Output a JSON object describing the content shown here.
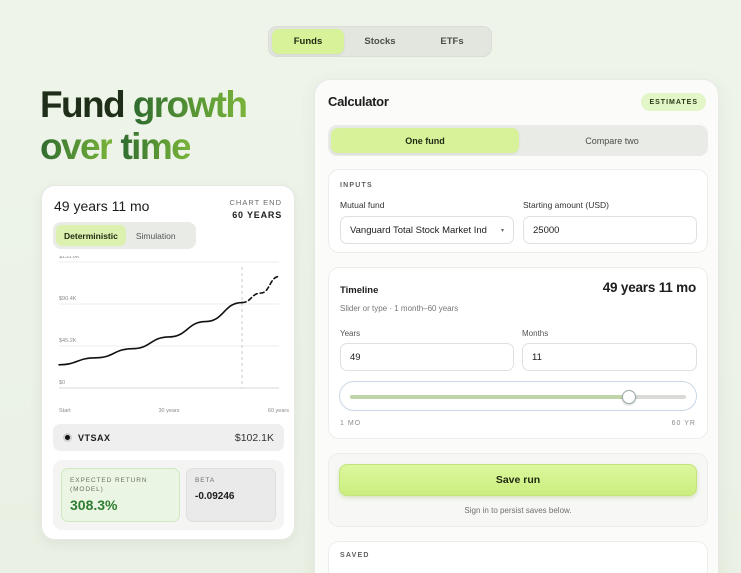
{
  "topnav": {
    "tabs": [
      "Funds",
      "Stocks",
      "ETFs"
    ],
    "active": "Funds"
  },
  "hero": {
    "line1_a": "Fund",
    "line1_b": "growth",
    "line2_a": "over",
    "line2_b": "time"
  },
  "chart_card": {
    "duration": "49 years 11 mo",
    "chart_end_label": "CHART END",
    "chart_end_value": "60 YEARS",
    "modes": [
      "Deterministic",
      "Simulation"
    ],
    "active_mode": "Deterministic",
    "fund_ticker": "VTSAX",
    "fund_value": "$102.1K",
    "expected_return_label": "EXPECTED RETURN (MODEL)",
    "expected_return_value": "308.3%",
    "beta_label": "BETA",
    "beta_value": "-0.09246"
  },
  "chart_data": {
    "type": "line",
    "x_ticks": [
      "Start",
      "30 years",
      "60 years"
    ],
    "y_ticks": [
      "$0",
      "$45.2K",
      "$90.4K",
      "$135.6K"
    ],
    "xlim": [
      0,
      60
    ],
    "ylim": [
      0,
      135600
    ],
    "marker_x": 49.92,
    "series": [
      {
        "style": "solid",
        "x": [
          0,
          10,
          20,
          30,
          40,
          49.92
        ],
        "y": [
          25000,
          32500,
          42300,
          55000,
          71500,
          92000
        ]
      },
      {
        "style": "dashed",
        "x": [
          49.92,
          55,
          60
        ],
        "y": [
          92000,
          102100,
          120000
        ]
      }
    ],
    "grid": true
  },
  "calculator": {
    "title": "Calculator",
    "badge": "ESTIMATES",
    "compare_modes": [
      "One fund",
      "Compare two"
    ],
    "active_compare": "One fund",
    "inputs_label": "INPUTS",
    "mutual_fund_label": "Mutual fund",
    "mutual_fund_value": "Vanguard Total Stock Market Ind",
    "starting_amount_label": "Starting amount (USD)",
    "starting_amount_value": "25000",
    "timeline_title": "Timeline",
    "timeline_value": "49 years 11 mo",
    "timeline_help": "Slider or type · 1 month–60 years",
    "years_label": "Years",
    "years_value": "49",
    "months_label": "Months",
    "months_value": "11",
    "slider_fraction": 0.831,
    "slider_min_label": "1 MO",
    "slider_max_label": "60 YR",
    "save_label": "Save run",
    "save_note": "Sign in to persist saves below.",
    "saved_label": "SAVED"
  }
}
